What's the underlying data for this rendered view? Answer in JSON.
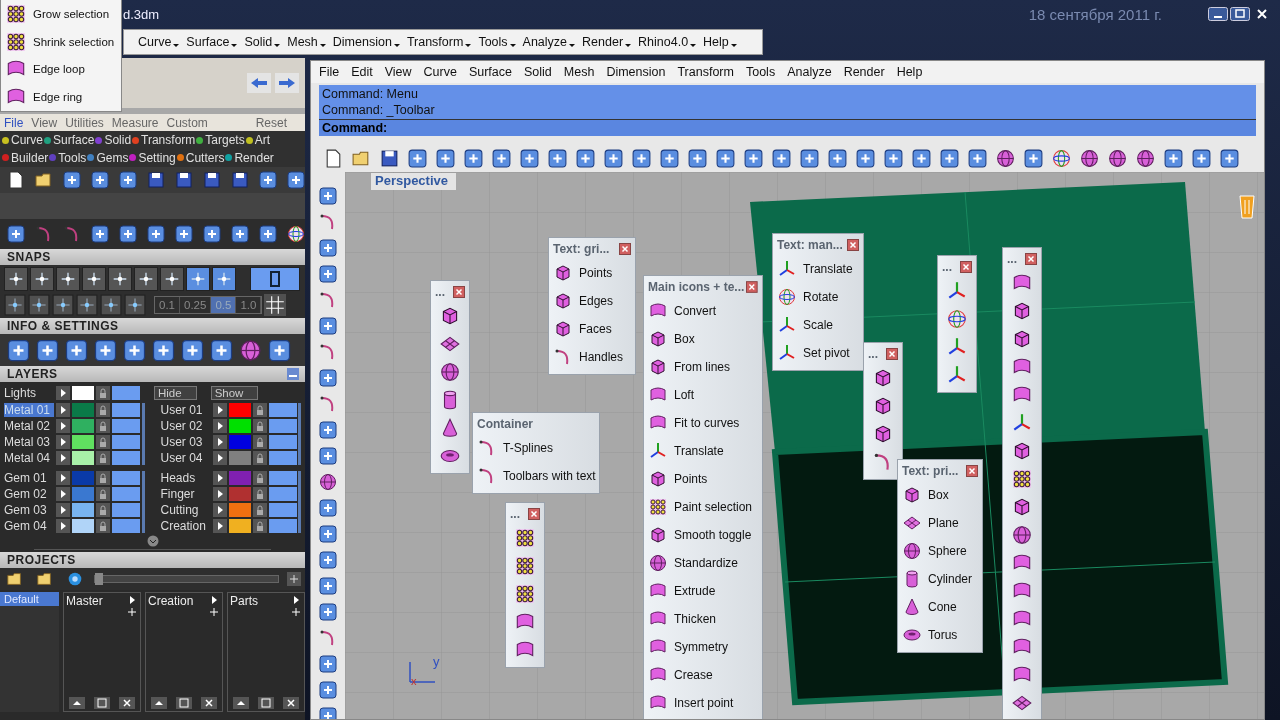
{
  "title_bar": {
    "title": "d.3dm",
    "date": "18 сентября 2011 г."
  },
  "popup_menu": [
    {
      "label": "Grow selection"
    },
    {
      "label": "Shrink selection"
    },
    {
      "label": "Edge loop"
    },
    {
      "label": "Edge ring"
    }
  ],
  "top_menu": [
    "Curve",
    "Surface",
    "Solid",
    "Mesh",
    "Dimension",
    "Transform",
    "Tools",
    "Analyze",
    "Render",
    "Rhino4.0",
    "Help"
  ],
  "side_panel": {
    "menu": [
      {
        "label": "File",
        "selected": true
      },
      {
        "label": "View",
        "selected": false
      },
      {
        "label": "Utilities",
        "selected": false
      },
      {
        "label": "Measure",
        "selected": false
      },
      {
        "label": "Custom",
        "selected": false
      }
    ],
    "reset": "Reset",
    "categories": [
      {
        "label": "Curve",
        "color": "#c8c020"
      },
      {
        "label": "Surface",
        "color": "#20a080"
      },
      {
        "label": "Solid",
        "color": "#8040d0"
      },
      {
        "label": "Transform",
        "color": "#e04020"
      },
      {
        "label": "Targets",
        "color": "#40b040"
      },
      {
        "label": "Art",
        "color": "#c0c020"
      },
      {
        "label": "Builder",
        "color": "#d02020"
      },
      {
        "label": "Tools",
        "color": "#6040c0"
      },
      {
        "label": "Gems",
        "color": "#4080c0"
      },
      {
        "label": "Setting",
        "color": "#c020c0"
      },
      {
        "label": "Cutters",
        "color": "#e07010"
      },
      {
        "label": "Render",
        "color": "#10a0a0"
      }
    ],
    "snaps": {
      "title": "SNAPS",
      "buttons": [
        {
          "selected": false
        },
        {
          "selected": false
        },
        {
          "selected": false
        },
        {
          "selected": false
        },
        {
          "selected": false
        },
        {
          "selected": false
        },
        {
          "selected": false
        },
        {
          "selected": true
        },
        {
          "selected": true
        }
      ],
      "ortho": {
        "selected": true
      },
      "steps": [
        {
          "label": "0.1",
          "selected": false
        },
        {
          "label": "0.25",
          "selected": false
        },
        {
          "label": "0.5",
          "selected": true
        },
        {
          "label": "1.0",
          "selected": false
        }
      ]
    },
    "info_title": "INFO & SETTINGS",
    "layers": {
      "title": "LAYERS",
      "lights": {
        "name": "Lights",
        "color": "#ffffff",
        "visible": true
      },
      "hide": "Hide",
      "show": "Show",
      "groups": [
        {
          "layers": [
            {
              "name": "Metal 01",
              "color": "#0a7a48",
              "selected": true,
              "visible": true
            },
            {
              "name": "Metal 02",
              "color": "#2fb060",
              "selected": false,
              "visible": true
            },
            {
              "name": "Metal 03",
              "color": "#60e060",
              "selected": false,
              "visible": true
            },
            {
              "name": "Metal 04",
              "color": "#a8f0a8",
              "selected": false,
              "visible": true
            }
          ]
        },
        {
          "layers": [
            {
              "name": "User 01",
              "color": "#ff0000",
              "selected": false,
              "visible": true
            },
            {
              "name": "User 02",
              "color": "#00e000",
              "selected": false,
              "visible": true
            },
            {
              "name": "User 03",
              "color": "#0000e0",
              "selected": false,
              "visible": true
            },
            {
              "name": "User 04",
              "color": "#808080",
              "selected": false,
              "visible": true
            }
          ]
        },
        {
          "layers": [
            {
              "name": "Gem 01",
              "color": "#0a3aa8",
              "selected": false,
              "visible": true
            },
            {
              "name": "Gem 02",
              "color": "#3a78d0",
              "selected": false,
              "visible": true
            },
            {
              "name": "Gem 03",
              "color": "#78b4f0",
              "selected": false,
              "visible": true
            },
            {
              "name": "Gem 04",
              "color": "#b0d4f8",
              "selected": false,
              "visible": true
            }
          ]
        },
        {
          "layers": [
            {
              "name": "Heads",
              "color": "#8020b0",
              "selected": false,
              "visible": true
            },
            {
              "name": "Finger",
              "color": "#b03030",
              "selected": false,
              "visible": true
            },
            {
              "name": "Cutting",
              "color": "#f07010",
              "selected": false,
              "visible": true
            },
            {
              "name": "Creation",
              "color": "#f0b020",
              "selected": false,
              "visible": true
            }
          ]
        }
      ]
    },
    "projects": {
      "title": "PROJECTS",
      "list": [
        {
          "label": "Default",
          "selected": true
        }
      ],
      "columns": [
        "Master",
        "Creation",
        "Parts"
      ]
    }
  },
  "rhino": {
    "menu": [
      "File",
      "Edit",
      "View",
      "Curve",
      "Surface",
      "Solid",
      "Mesh",
      "Dimension",
      "Transform",
      "Tools",
      "Analyze",
      "Render",
      "Help"
    ],
    "command": {
      "history": [
        "Command: Menu",
        "Command: _Toolbar"
      ],
      "prompt": "Command:"
    },
    "viewport": {
      "title": "Perspective",
      "axis_labels": [
        "y",
        "x"
      ],
      "panels": [
        {
          "kind": "icons",
          "title": "..."
        },
        {
          "kind": "text",
          "title": "Text: gri...",
          "items": [
            "Points",
            "Edges",
            "Faces",
            "Handles"
          ]
        },
        {
          "kind": "container",
          "title": "Container",
          "items": [
            "T-Splines",
            "Toolbars with text"
          ]
        },
        {
          "kind": "icons",
          "title": "..."
        },
        {
          "kind": "text",
          "title": "Main icons + te...",
          "items": [
            "Convert",
            "Box",
            "From lines",
            "Loft",
            "Fit to curves",
            "Translate",
            "Points",
            "Paint selection",
            "Smooth toggle",
            "Standardize",
            "Extrude",
            "Thicken",
            "Symmetry",
            "Crease",
            "Insert point"
          ]
        },
        {
          "kind": "text",
          "title": "Text: man...",
          "items": [
            "Translate",
            "Rotate",
            "Scale",
            "Set pivot"
          ]
        },
        {
          "kind": "icons",
          "title": "..."
        },
        {
          "kind": "icons",
          "title": "..."
        },
        {
          "kind": "text",
          "title": "Text: pri...",
          "items": [
            "Box",
            "Plane",
            "Sphere",
            "Cylinder",
            "Cone",
            "Torus"
          ]
        },
        {
          "kind": "icons",
          "title": "..."
        }
      ]
    }
  }
}
